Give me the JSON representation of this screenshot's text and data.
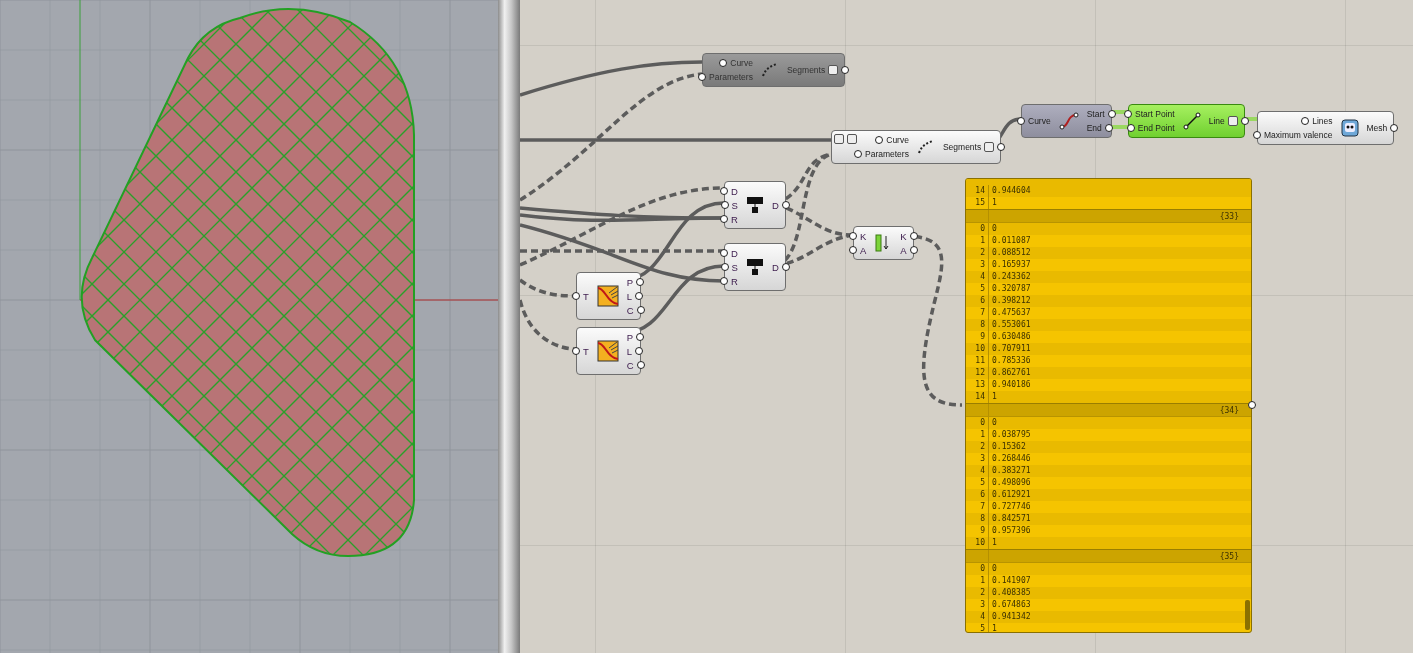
{
  "nodes": [
    {
      "kind": "shatter",
      "disabled": true,
      "selected": false,
      "preview_hidden": false,
      "side_buttons": false,
      "inputs": [
        "Curve",
        "Parameters"
      ],
      "outputs": [
        {
          "label": "Segments",
          "flatten": true
        }
      ]
    },
    {
      "kind": "shatter",
      "disabled": false,
      "selected": false,
      "preview_hidden": false,
      "side_buttons": true,
      "inputs": [
        "Curve",
        "Parameters"
      ],
      "outputs": [
        {
          "label": "Segments",
          "flatten": true
        }
      ]
    },
    {
      "kind": "endpoints",
      "disabled": false,
      "selected": false,
      "preview_hidden": true,
      "side_buttons": false,
      "inputs": [
        "Curve"
      ],
      "outputs": [
        {
          "label": "Start",
          "flatten": false
        },
        {
          "label": "End",
          "flatten": false
        }
      ]
    },
    {
      "kind": "line",
      "disabled": false,
      "selected": true,
      "preview_hidden": false,
      "side_buttons": false,
      "inputs": [
        "Start Point",
        "End Point"
      ],
      "outputs": [
        {
          "label": "Line",
          "flatten": true
        }
      ]
    },
    {
      "kind": "mesh",
      "disabled": false,
      "selected": false,
      "preview_hidden": false,
      "side_buttons": false,
      "inputs": [
        "Lines",
        "Maximum valence"
      ],
      "outputs": [
        {
          "label": "Mesh",
          "flatten": false
        }
      ]
    },
    {
      "kind": "text",
      "disabled": false,
      "selected": false,
      "preview_hidden": false,
      "side_buttons": false,
      "inputs": [
        "D",
        "S",
        "R"
      ],
      "outputs": [
        {
          "label": "D",
          "flatten": false
        }
      ]
    },
    {
      "kind": "text",
      "disabled": false,
      "selected": false,
      "preview_hidden": false,
      "side_buttons": false,
      "inputs": [
        "D",
        "S",
        "R"
      ],
      "outputs": [
        {
          "label": "D",
          "flatten": false
        }
      ]
    },
    {
      "kind": "sort",
      "disabled": false,
      "selected": false,
      "preview_hidden": false,
      "side_buttons": false,
      "inputs": [
        "K",
        "A"
      ],
      "outputs": [
        {
          "label": "K",
          "flatten": false
        },
        {
          "label": "A",
          "flatten": false
        }
      ]
    },
    {
      "kind": "graph",
      "disabled": false,
      "selected": false,
      "preview_hidden": false,
      "side_buttons": false,
      "inputs": [
        "T"
      ],
      "outputs": [
        {
          "label": "P",
          "flatten": false
        },
        {
          "label": "L",
          "flatten": false
        },
        {
          "label": "C",
          "flatten": false
        }
      ]
    },
    {
      "kind": "graph",
      "disabled": false,
      "selected": false,
      "preview_hidden": false,
      "side_buttons": false,
      "inputs": [
        "T"
      ],
      "outputs": [
        {
          "label": "P",
          "flatten": false
        },
        {
          "label": "L",
          "flatten": false
        },
        {
          "label": "C",
          "flatten": false
        }
      ]
    }
  ],
  "panel": {
    "rows": [
      {
        "index": "14",
        "value": "0.944604"
      },
      {
        "index": "15",
        "value": "1"
      }
    ],
    "branches": [
      {
        "path": "{33}",
        "rows": [
          {
            "index": "0",
            "value": "0"
          },
          {
            "index": "1",
            "value": "0.011087"
          },
          {
            "index": "2",
            "value": "0.088512"
          },
          {
            "index": "3",
            "value": "0.165937"
          },
          {
            "index": "4",
            "value": "0.243362"
          },
          {
            "index": "5",
            "value": "0.320787"
          },
          {
            "index": "6",
            "value": "0.398212"
          },
          {
            "index": "7",
            "value": "0.475637"
          },
          {
            "index": "8",
            "value": "0.553061"
          },
          {
            "index": "9",
            "value": "0.630486"
          },
          {
            "index": "10",
            "value": "0.707911"
          },
          {
            "index": "11",
            "value": "0.785336"
          },
          {
            "index": "12",
            "value": "0.862761"
          },
          {
            "index": "13",
            "value": "0.940186"
          },
          {
            "index": "14",
            "value": "1"
          }
        ]
      },
      {
        "path": "{34}",
        "rows": [
          {
            "index": "0",
            "value": "0"
          },
          {
            "index": "1",
            "value": "0.038795"
          },
          {
            "index": "2",
            "value": "0.15362"
          },
          {
            "index": "3",
            "value": "0.268446"
          },
          {
            "index": "4",
            "value": "0.383271"
          },
          {
            "index": "5",
            "value": "0.498096"
          },
          {
            "index": "6",
            "value": "0.612921"
          },
          {
            "index": "7",
            "value": "0.727746"
          },
          {
            "index": "8",
            "value": "0.842571"
          },
          {
            "index": "9",
            "value": "0.957396"
          },
          {
            "index": "10",
            "value": "1"
          }
        ]
      },
      {
        "path": "{35}",
        "rows": [
          {
            "index": "0",
            "value": "0"
          },
          {
            "index": "1",
            "value": "0.141907"
          },
          {
            "index": "2",
            "value": "0.408385"
          },
          {
            "index": "3",
            "value": "0.674863"
          },
          {
            "index": "4",
            "value": "0.941342"
          },
          {
            "index": "5",
            "value": "1"
          }
        ]
      }
    ]
  }
}
